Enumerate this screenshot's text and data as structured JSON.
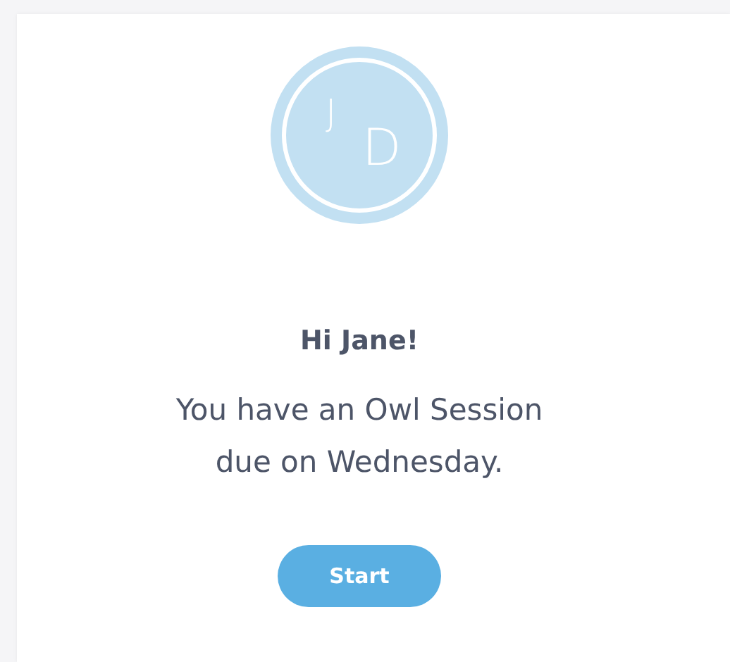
{
  "avatar": {
    "initials": [
      "J",
      "D"
    ]
  },
  "greeting": "Hi Jane!",
  "message": [
    "You have an Owl Session",
    "due on Wednesday."
  ],
  "button": "Start"
}
